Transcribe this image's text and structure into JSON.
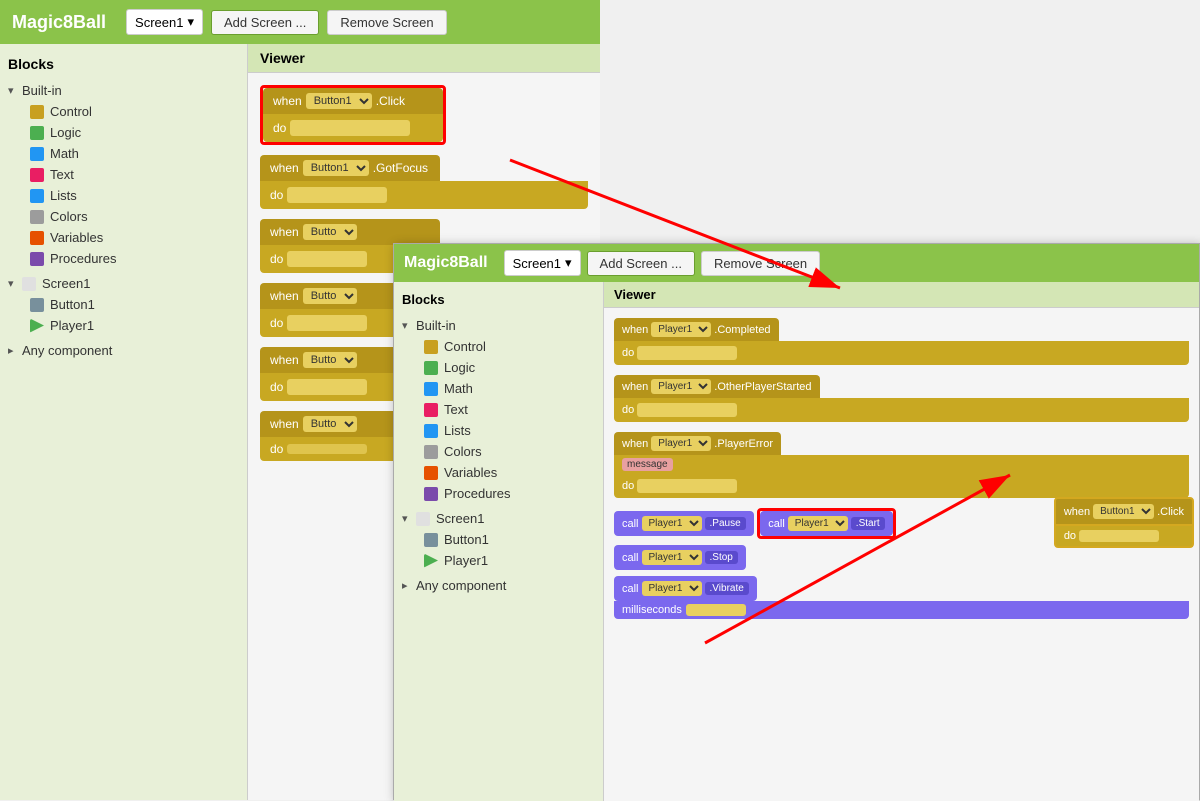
{
  "mainWindow": {
    "title": "Magic8Ball",
    "header": {
      "title": "Magic8Ball",
      "screenDropdown": "Screen1",
      "addScreenBtn": "Add Screen ...",
      "removeScreenBtn": "Remove Screen"
    },
    "blocks": {
      "panelTitle": "Blocks",
      "builtIn": {
        "label": "Built-in",
        "items": [
          {
            "label": "Control",
            "color": "#c8a020"
          },
          {
            "label": "Logic",
            "color": "#4caf50"
          },
          {
            "label": "Math",
            "color": "#2196f3"
          },
          {
            "label": "Text",
            "color": "#e91e63"
          },
          {
            "label": "Lists",
            "color": "#2196f3"
          },
          {
            "label": "Colors",
            "color": "#9c9c9c"
          },
          {
            "label": "Variables",
            "color": "#e65100"
          },
          {
            "label": "Procedures",
            "color": "#7b4bab"
          }
        ]
      },
      "screen1": {
        "label": "Screen1",
        "items": [
          {
            "label": "Button1",
            "color": "#78909c"
          },
          {
            "label": "Player1",
            "color": "#4caf50"
          }
        ]
      },
      "anyComponent": "Any component"
    },
    "viewer": {
      "title": "Viewer",
      "blocks": [
        {
          "type": "when",
          "component": "Button1",
          "event": ".Click",
          "hasHighlight": true
        },
        {
          "type": "when",
          "component": "Button1",
          "event": ".GotFocus",
          "hasHighlight": false
        },
        {
          "type": "when",
          "component": "Butto",
          "event": "",
          "hasHighlight": false
        },
        {
          "type": "when",
          "component": "Butto",
          "event": "",
          "hasHighlight": false
        },
        {
          "type": "when",
          "component": "Butto",
          "event": "",
          "hasHighlight": false
        },
        {
          "type": "when",
          "component": "Butto",
          "event": "",
          "hasHighlight": false
        }
      ]
    }
  },
  "secondWindow": {
    "title": "Magic8Ball",
    "header": {
      "screenDropdown": "Screen1",
      "addScreenBtn": "Add Screen ...",
      "removeScreenBtn": "Remove Screen"
    },
    "blocks": {
      "panelTitle": "Blocks",
      "builtIn": {
        "label": "Built-in",
        "items": [
          {
            "label": "Control",
            "color": "#c8a020"
          },
          {
            "label": "Logic",
            "color": "#4caf50"
          },
          {
            "label": "Math",
            "color": "#2196f3"
          },
          {
            "label": "Text",
            "color": "#e91e63"
          },
          {
            "label": "Lists",
            "color": "#2196f3"
          },
          {
            "label": "Colors",
            "color": "#9c9c9c"
          },
          {
            "label": "Variables",
            "color": "#e65100"
          },
          {
            "label": "Procedures",
            "color": "#7b4bab"
          }
        ]
      },
      "screen1": {
        "label": "Screen1",
        "items": [
          {
            "label": "Button1",
            "color": "#78909c"
          },
          {
            "label": "Player1",
            "color": "#4caf50"
          }
        ]
      },
      "anyComponent": "Any component"
    },
    "viewer": {
      "title": "Viewer",
      "blocks": [
        {
          "type": "when",
          "component": "Player1",
          "event": ".Completed"
        },
        {
          "type": "when",
          "component": "Player1",
          "event": ".OtherPlayerStarted"
        },
        {
          "type": "when",
          "component": "Player1",
          "event": ".PlayerError",
          "hasMsg": true
        },
        {
          "type": "call",
          "component": "Player1",
          "method": ".Pause"
        },
        {
          "type": "call",
          "component": "Player1",
          "method": ".Start",
          "hasHighlight": true
        },
        {
          "type": "call",
          "component": "Player1",
          "method": ".Stop"
        },
        {
          "type": "call",
          "component": "Player1",
          "method": ".Vibrate",
          "hasMillis": true
        }
      ]
    }
  },
  "floatingBlock": {
    "component": "Button1",
    "event": ".Click"
  },
  "labels": {
    "when": "when",
    "do": "do",
    "call": "call",
    "message": "message",
    "milliseconds": "milliseconds",
    "builtIn": "Built-in",
    "screen1": "Screen1",
    "anyComponent": "Any component",
    "blocksTitle": "Blocks",
    "viewerTitle": "Viewer"
  }
}
